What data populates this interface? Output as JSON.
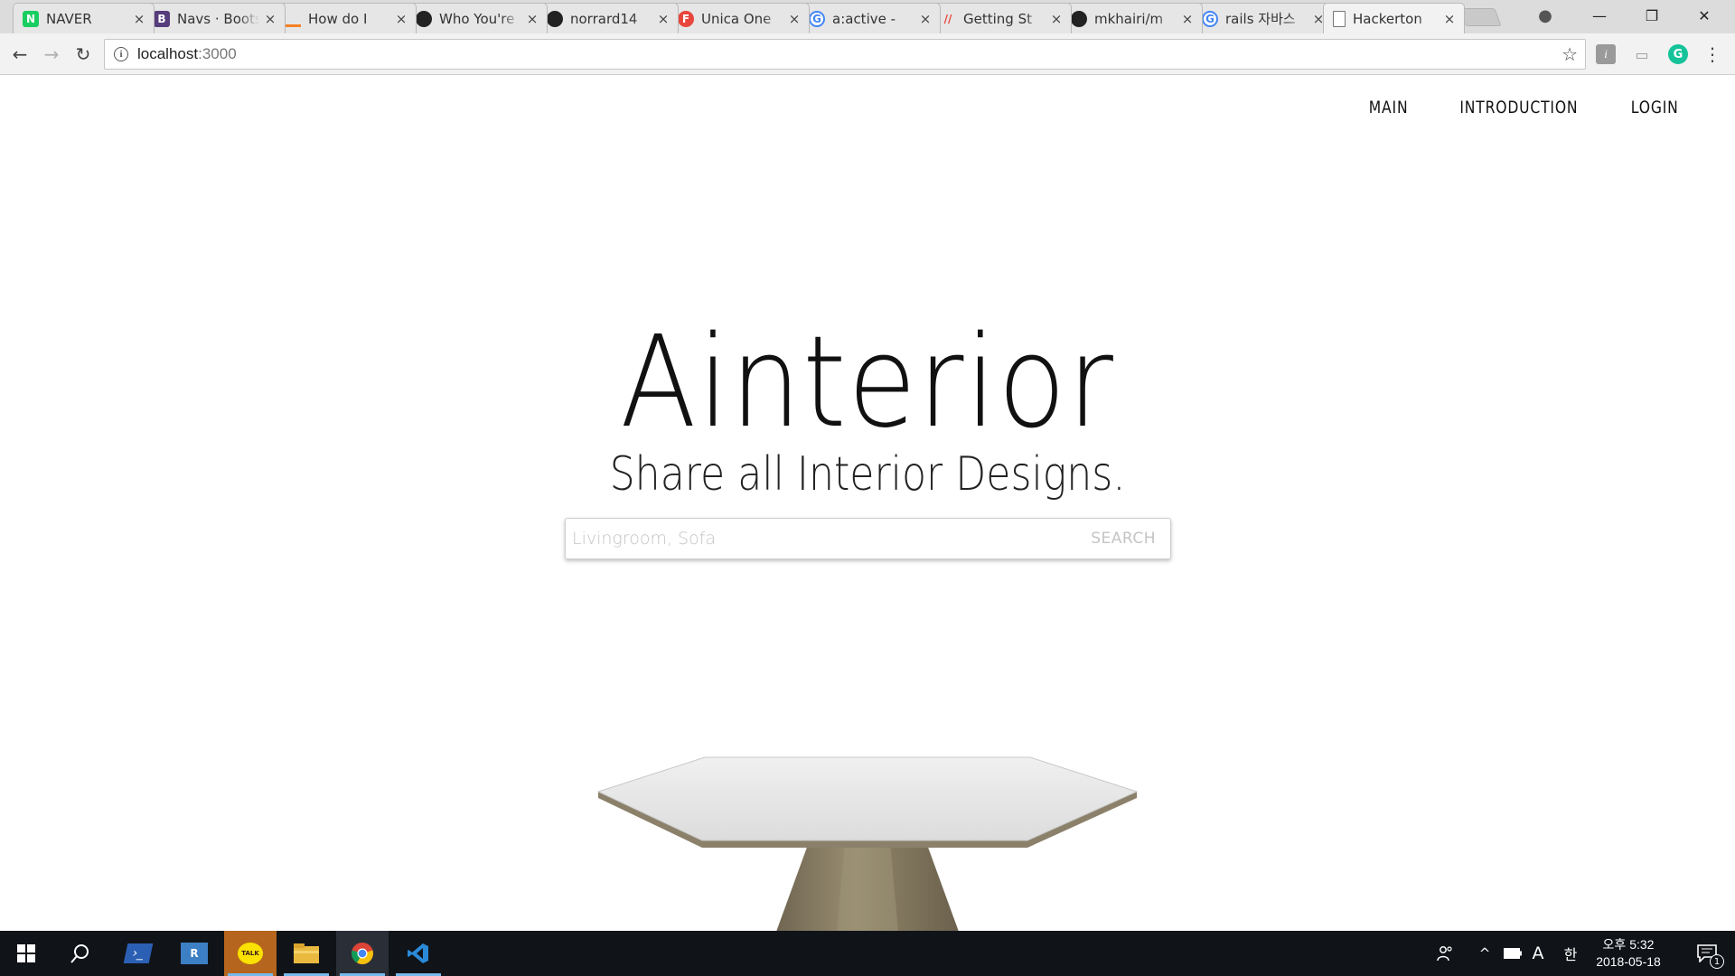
{
  "browser": {
    "tabs": [
      {
        "title": "NAVER",
        "icon": "naver-icon",
        "color": "#19ce60",
        "glyph": "N"
      },
      {
        "title": "Navs · Bootstrap",
        "icon": "bootstrap-icon",
        "color": "#563d7c",
        "glyph": "B"
      },
      {
        "title": "How do I",
        "icon": "stackoverflow-icon",
        "color": "#f48024",
        "glyph": ""
      },
      {
        "title": "Who You're",
        "icon": "github-icon",
        "color": "#222222",
        "glyph": ""
      },
      {
        "title": "norrard14",
        "icon": "github-icon",
        "color": "#222222",
        "glyph": ""
      },
      {
        "title": "Unica One",
        "icon": "fonts-icon",
        "color": "#e8453c",
        "glyph": "F"
      },
      {
        "title": "a:active -",
        "icon": "google-icon",
        "color": "#4285f4",
        "glyph": "G"
      },
      {
        "title": "Getting St",
        "icon": "heroku-icon",
        "color": "#e8453c",
        "glyph": "//"
      },
      {
        "title": "mkhairi/m",
        "icon": "github-icon",
        "color": "#222222",
        "glyph": ""
      },
      {
        "title": "rails 자바스",
        "icon": "google-icon",
        "color": "#4285f4",
        "glyph": "G"
      },
      {
        "title": "Hackerton",
        "icon": "page-icon",
        "color": "#777777",
        "glyph": "",
        "active": true
      }
    ],
    "close_glyph": "×",
    "window_controls": {
      "minimize": "—",
      "restore": "❐",
      "close": "✕"
    },
    "profile_glyph": "●",
    "url_host": "localhost",
    "url_port": ":3000",
    "info_glyph": "i",
    "star_glyph": "☆",
    "back_glyph": "←",
    "forward_glyph": "→",
    "reload_glyph": "↻",
    "menu_glyph": "⋮",
    "extensions": {
      "info": "i",
      "cast": "▭",
      "grammarly": "G"
    }
  },
  "site": {
    "nav": [
      "MAIN",
      "INTRODUCTION",
      "LOGIN"
    ],
    "title": "Ainterior",
    "subtitle": "Share all Interior Designs.",
    "search_placeholder": "Livingroom, Sofa",
    "search_button": "SEARCH",
    "hero_image": "hexagon-table-image",
    "colors": {
      "text": "#111111",
      "placeholder": "#c4c4c4",
      "table_top": "#e6e6e6",
      "table_base": "#857a5e"
    }
  },
  "taskbar": {
    "apps": [
      "start-icon",
      "search-icon",
      "powershell-icon",
      "remote-desktop-icon",
      "kakaotalk-icon",
      "file-explorer-icon",
      "chrome-icon",
      "vscode-icon"
    ],
    "kakao_label": "TALK",
    "tray": {
      "people": "people-icon",
      "chevron": "^",
      "battery": "battery-icon",
      "ime": "A",
      "lang": "한"
    },
    "clock_time": "오후 5:32",
    "clock_date": "2018-05-18",
    "notifications": "1"
  }
}
